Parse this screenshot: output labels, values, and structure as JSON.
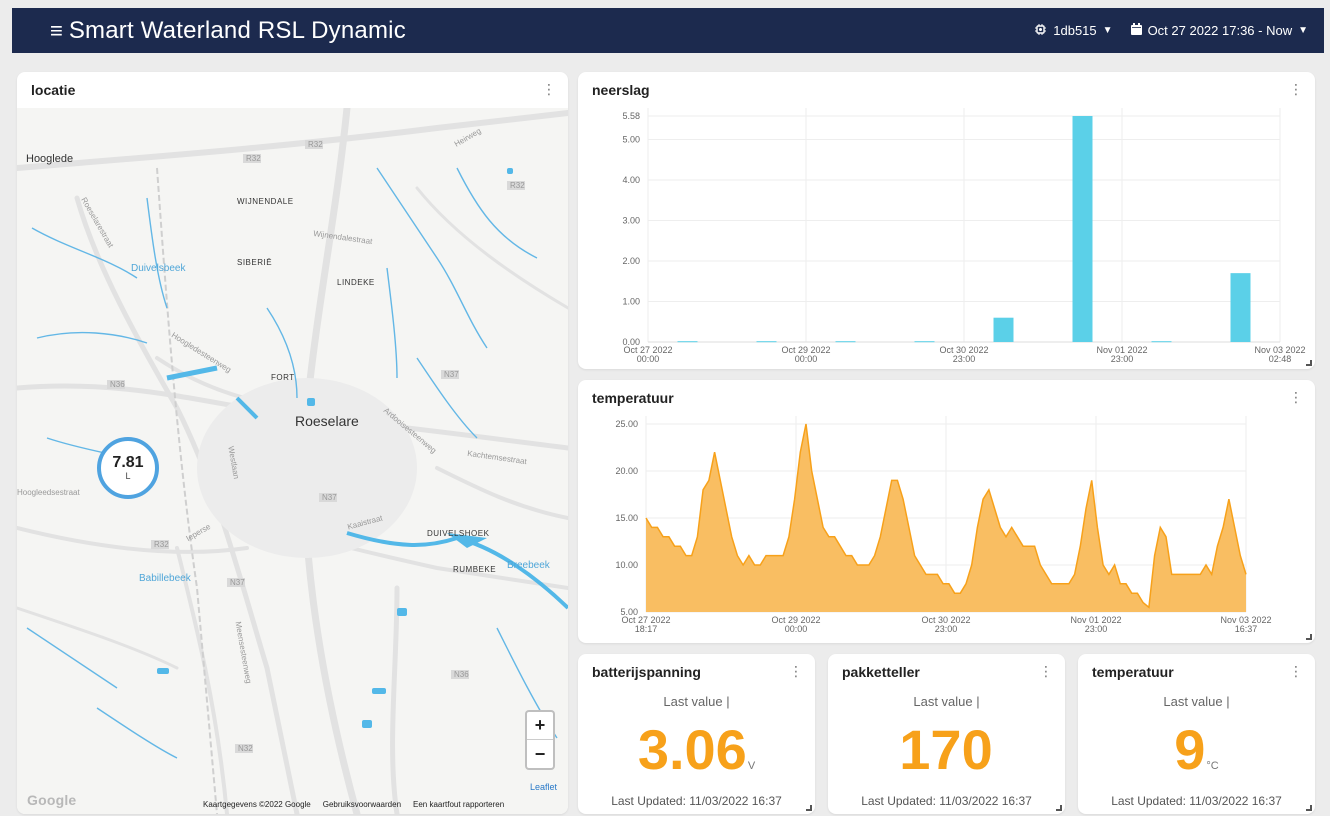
{
  "header": {
    "title": "Smart Waterland RSL Dynamic",
    "device": "1db515",
    "timerange": "Oct 27 2022 17:36 - Now"
  },
  "map_card": {
    "title": "locatie",
    "marker_value": "7.81",
    "marker_unit": "L",
    "labels": {
      "hooglede": "Hooglede",
      "wijnendale": "WIJNENDALE",
      "siberie": "SIBERIË",
      "lindeke": "LINDEKE",
      "fort": "FORT",
      "roeselare": "Roeselare",
      "duivelshoek": "DUIVELSHOEK",
      "rumbeke": "RUMBEKE",
      "duivelsbeek": "Duivelsbeek",
      "babillebeek": "Babillebeek",
      "breebeek": "Breebeek",
      "r32a": "R32",
      "r32b": "R32",
      "r32c": "R32",
      "r32d": "R32",
      "n36": "N36",
      "n37a": "N37",
      "n37b": "N37",
      "n37c": "N37",
      "n36b": "N36",
      "n32": "N32",
      "kachtem": "Kachtemsestraat",
      "wijnendale_st": "Wijnendalestraat",
      "heirweg": "Heirweg",
      "meensesteenweg": "Meensesteenweg",
      "westlaan": "Westlaan",
      "ieperse": "Ieperse",
      "hooglede_st": "Hoogledesteenweg",
      "roeselare_st": "Roeselarestraat",
      "hoogleedsestraat": "Hoogleedsestraat",
      "kaaistraat": "Kaaistraat",
      "zijdelings": "Ardooisesteenweg"
    },
    "zoom_in": "+",
    "zoom_out": "−",
    "leaflet": "Leaflet",
    "google": "Google",
    "attribution": [
      "Kaartgegevens ©2022 Google",
      "Gebruiksvoorwaarden",
      "Een kaartfout rapporteren"
    ]
  },
  "neerslag_card": {
    "title": "neerslag"
  },
  "temp_card": {
    "title": "temperatuur"
  },
  "cards": {
    "batterij": {
      "title": "batterijspanning",
      "last_label": "Last value |",
      "value": "3.06",
      "unit": "V",
      "updated": "Last Updated: 11/03/2022 16:37"
    },
    "pakket": {
      "title": "pakketteller",
      "last_label": "Last value |",
      "value": "170",
      "unit": "",
      "updated": "Last Updated: 11/03/2022 16:37"
    },
    "temperatuur": {
      "title": "temperatuur",
      "last_label": "Last value |",
      "value": "9",
      "unit": "°C",
      "updated": "Last Updated: 11/03/2022 16:37"
    }
  },
  "chart_data": [
    {
      "type": "bar",
      "title": "neerslag",
      "color": "#5bd0e8",
      "yticks": [
        "0.00",
        "1.00",
        "2.00",
        "3.00",
        "4.00",
        "5.00",
        "5.58"
      ],
      "ylim": [
        0,
        5.58
      ],
      "xticks": [
        {
          "line1": "Oct 27 2022",
          "line2": "00:00"
        },
        {
          "line1": "Oct 29 2022",
          "line2": "00:00"
        },
        {
          "line1": "Oct 30 2022",
          "line2": "23:00"
        },
        {
          "line1": "Nov 01 2022",
          "line2": "23:00"
        },
        {
          "line1": "Nov 03 2022",
          "line2": "02:48"
        }
      ],
      "values": [
        0.02,
        0.02,
        0.02,
        0.02,
        0.6,
        5.58,
        0.02,
        1.7
      ]
    },
    {
      "type": "area",
      "title": "temperatuur",
      "color": "#f7a11a",
      "fill": "#f9be62",
      "yticks": [
        "5.00",
        "10.00",
        "15.00",
        "20.00",
        "25.00"
      ],
      "ylim": [
        5,
        25
      ],
      "xticks": [
        {
          "line1": "Oct 27 2022",
          "line2": "18:17"
        },
        {
          "line1": "Oct 29 2022",
          "line2": "00:00"
        },
        {
          "line1": "Oct 30 2022",
          "line2": "23:00"
        },
        {
          "line1": "Nov 01 2022",
          "line2": "23:00"
        },
        {
          "line1": "Nov 03 2022",
          "line2": "16:37"
        }
      ],
      "values": [
        15,
        14,
        14,
        13,
        13,
        12,
        12,
        11,
        11,
        13,
        18,
        19,
        22,
        19,
        16,
        13,
        11,
        10,
        11,
        10,
        10,
        11,
        11,
        11,
        11,
        13,
        17,
        22,
        25,
        20,
        17,
        14,
        13,
        13,
        12,
        11,
        11,
        10,
        10,
        10,
        11,
        13,
        16,
        19,
        19,
        17,
        14,
        11,
        10,
        9,
        9,
        9,
        8,
        8,
        7,
        7,
        8,
        10,
        14,
        17,
        18,
        16,
        14,
        13,
        14,
        13,
        12,
        12,
        12,
        10,
        9,
        8,
        8,
        8,
        8,
        9,
        12,
        16,
        19,
        14,
        10,
        9,
        10,
        8,
        8,
        7,
        7,
        6,
        5.5,
        11,
        14,
        13,
        9,
        9,
        9,
        9,
        9,
        9,
        10,
        9,
        12,
        14,
        17,
        14,
        11,
        9
      ]
    }
  ]
}
